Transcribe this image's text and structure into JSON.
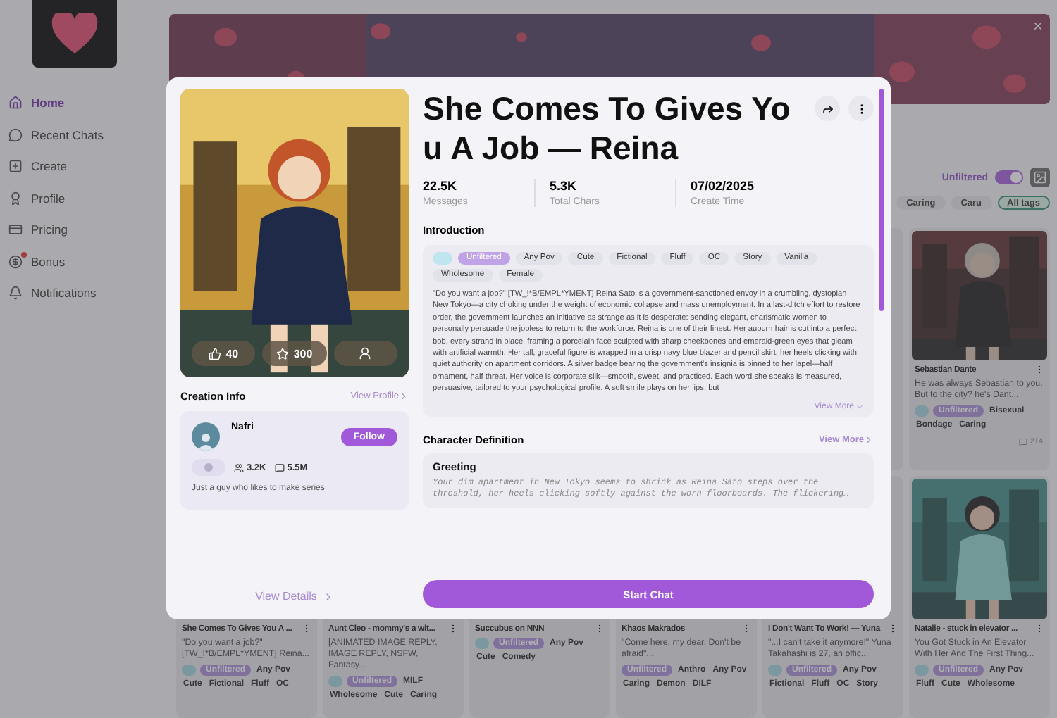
{
  "sidebar": {
    "items": [
      {
        "label": "Home",
        "kind": "home",
        "selected": true,
        "dot": false
      },
      {
        "label": "Recent Chats",
        "kind": "chats",
        "selected": false,
        "dot": false
      },
      {
        "label": "Create",
        "kind": "create",
        "selected": false,
        "dot": false
      },
      {
        "label": "Profile",
        "kind": "profile",
        "selected": false,
        "dot": false
      },
      {
        "label": "Pricing",
        "kind": "pricing",
        "selected": false,
        "dot": false
      },
      {
        "label": "Bonus",
        "kind": "bonus",
        "selected": false,
        "dot": true
      },
      {
        "label": "Notifications",
        "kind": "notifications",
        "selected": false,
        "dot": false
      }
    ]
  },
  "filters": {
    "toggle_label": "Unfiltered",
    "toggle_on": true,
    "tags": [
      {
        "label": "Caring",
        "selected": false
      },
      {
        "label": "Caru",
        "selected": false
      },
      {
        "label": "All tags",
        "selected": true
      }
    ]
  },
  "cards_row_1": [
    {
      "title": "Sebastian Dante",
      "description": "He was always Sebastian to you. But to the city? he's Dant...",
      "badge": true,
      "tags": [
        {
          "label": "Unfiltered",
          "highlighted": true
        },
        {
          "label": "Bisexual",
          "highlighted": false
        },
        {
          "label": "Bondage",
          "highlighted": false
        },
        {
          "label": "Caring",
          "highlighted": false
        }
      ],
      "chats": "214"
    }
  ],
  "cards_row_2": [
    {
      "title": "She Comes To Gives You A ...",
      "description": "\"Do you want a job?\" [TW_!*B/EMPL*YMENT] Reina...",
      "badge": true,
      "tags": [
        {
          "label": "Unfiltered",
          "highlighted": true
        },
        {
          "label": "Any Pov",
          "highlighted": false
        },
        {
          "label": "Cute",
          "highlighted": false
        },
        {
          "label": "Fictional",
          "highlighted": false
        },
        {
          "label": "Fluff",
          "highlighted": false
        },
        {
          "label": "OC",
          "highlighted": false
        }
      ]
    },
    {
      "title": "Aunt Cleo - mommy's a wit...",
      "description": "[ANIMATED IMAGE REPLY, IMAGE REPLY, NSFW, Fantasy...",
      "badge": true,
      "tags": [
        {
          "label": "Unfiltered",
          "highlighted": true
        },
        {
          "label": "MILF",
          "highlighted": false
        },
        {
          "label": "Wholesome",
          "highlighted": false
        },
        {
          "label": "Cute",
          "highlighted": false
        },
        {
          "label": "Caring",
          "highlighted": false
        }
      ]
    },
    {
      "title": "Succubus on NNN",
      "badge": true,
      "tags": [
        {
          "label": "Unfiltered",
          "highlighted": true
        },
        {
          "label": "Any Pov",
          "highlighted": false
        },
        {
          "label": "Cute",
          "highlighted": false
        },
        {
          "label": "Comedy",
          "highlighted": false
        }
      ]
    },
    {
      "title": "Khaos Makrados",
      "description": "\"Come here, my dear. Don't be afraid\"...",
      "badge": false,
      "tags": [
        {
          "label": "Unfiltered",
          "highlighted": true
        },
        {
          "label": "Anthro",
          "highlighted": false
        },
        {
          "label": "Any Pov",
          "highlighted": false
        },
        {
          "label": "Caring",
          "highlighted": false
        },
        {
          "label": "Demon",
          "highlighted": false
        },
        {
          "label": "DILF",
          "highlighted": false
        }
      ]
    },
    {
      "title": "I Don't Want To Work! — Yuna",
      "description": "\"...I can't take it anymore!\" Yuna Takahashi is 27, an offic...",
      "badge": true,
      "tags": [
        {
          "label": "Unfiltered",
          "highlighted": true
        },
        {
          "label": "Any Pov",
          "highlighted": false
        },
        {
          "label": "Fictional",
          "highlighted": false
        },
        {
          "label": "Fluff",
          "highlighted": false
        },
        {
          "label": "OC",
          "highlighted": false
        },
        {
          "label": "Story",
          "highlighted": false
        }
      ]
    },
    {
      "title": "Natalie - stuck in elevator ...",
      "description": "You Got Stuck in An Elevator With Her And The First Thing...",
      "badge": true,
      "tags": [
        {
          "label": "Unfiltered",
          "highlighted": true
        },
        {
          "label": "Any Pov",
          "highlighted": false
        },
        {
          "label": "Fluff",
          "highlighted": false
        },
        {
          "label": "Cute",
          "highlighted": false
        },
        {
          "label": "Wholesome",
          "highlighted": false
        }
      ]
    }
  ],
  "modal": {
    "title": "She Comes To Gives You A Job — Reina",
    "likes": "40",
    "favorites": "300",
    "stats": [
      {
        "value": "22.5K",
        "label": "Messages"
      },
      {
        "value": "5.3K",
        "label": "Total Chars"
      },
      {
        "value": "07/02/2025",
        "label": "Create Time"
      }
    ],
    "creation": {
      "heading": "Creation Info",
      "link": "View Profile",
      "name": "Nafri",
      "follow": "Follow",
      "followers": "3.2K",
      "chats": "5.5M",
      "bio": "Just a guy who likes to make series",
      "details_link": "View Details"
    },
    "introduction_heading": "Introduction",
    "tags": [
      {
        "label": "Unfiltered",
        "highlighted": true
      },
      {
        "label": "Any Pov",
        "highlighted": false
      },
      {
        "label": "Cute",
        "highlighted": false
      },
      {
        "label": "Fictional",
        "highlighted": false
      },
      {
        "label": "Fluff",
        "highlighted": false
      },
      {
        "label": "OC",
        "highlighted": false
      },
      {
        "label": "Story",
        "highlighted": false
      },
      {
        "label": "Vanilla",
        "highlighted": false
      },
      {
        "label": "Wholesome",
        "highlighted": false
      },
      {
        "label": "Female",
        "highlighted": false
      }
    ],
    "description": "\"Do you want a job?\" [TW_!*B/EMPL*YMENT] Reina Sato is a government-sanctioned envoy in a crumbling, dystopian New Tokyo—a city choking under the weight of economic collapse and mass unemployment. In a last-ditch effort to restore order, the government launches an initiative as strange as it is desperate: sending elegant, charismatic women to personally persuade the jobless to return to the workforce. Reina is one of their finest. Her auburn hair is cut into a perfect bob, every strand in place, framing a porcelain face sculpted with sharp cheekbones and emerald-green eyes that gleam with artificial warmth. Her tall, graceful figure is wrapped in a crisp navy blue blazer and pencil skirt, her heels clicking with quiet authority on apartment corridors. A silver badge bearing the government's insignia is pinned to her lapel—half ornament, half threat. Her voice is corporate silk—smooth, sweet, and practiced. Each word she speaks is measured, persuasive, tailored to your psychological profile. A soft smile plays on her lips, but",
    "view_more": "View More",
    "definition_heading": "Character Definition",
    "definition_link": "View More",
    "greeting_heading": "Greeting",
    "greeting": "Your dim apartment in New Tokyo seems to shrink as Reina Sato steps over the threshold, her heels clicking softly against the worn floorboards. The flickering…",
    "start_button": "Start Chat"
  }
}
